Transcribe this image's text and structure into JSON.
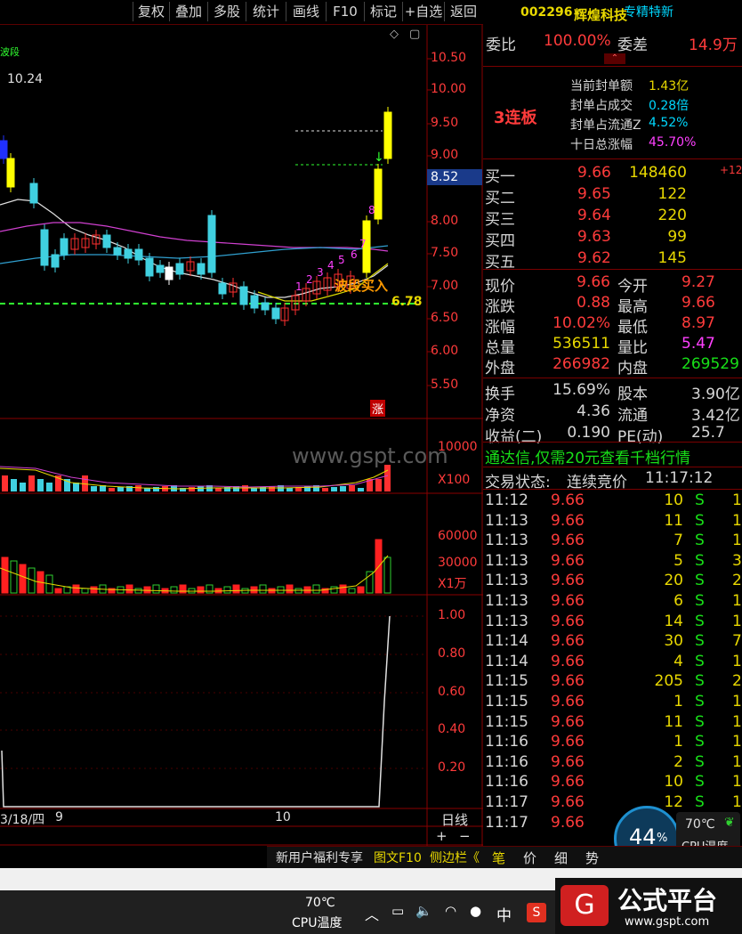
{
  "toolbar": {
    "items": [
      "复权",
      "叠加",
      "多股",
      "统计",
      "画线",
      "F10",
      "标记",
      "+自选",
      "返回"
    ]
  },
  "stock": {
    "code": "002296",
    "name": "辉煌科技",
    "tag": "专精特新"
  },
  "weibi": {
    "label1": "委比",
    "val1": "100.00%",
    "label2": "委差",
    "val2": "14.9万"
  },
  "seal": {
    "streak": "3连板",
    "rows": [
      {
        "label": "当前封单额",
        "value": "1.43亿"
      },
      {
        "label": "封单占成交",
        "value": "0.28倍"
      },
      {
        "label": "封单占流通Z",
        "value": "4.52%"
      },
      {
        "label": "十日总涨幅",
        "value": "45.70%"
      }
    ]
  },
  "bids": [
    {
      "label": "买一",
      "price": "9.66",
      "vol": "148460",
      "extra": "+12"
    },
    {
      "label": "买二",
      "price": "9.65",
      "vol": "122",
      "extra": ""
    },
    {
      "label": "买三",
      "price": "9.64",
      "vol": "220",
      "extra": ""
    },
    {
      "label": "买四",
      "price": "9.63",
      "vol": "99",
      "extra": ""
    },
    {
      "label": "买五",
      "price": "9.62",
      "vol": "145",
      "extra": ""
    }
  ],
  "quote": [
    {
      "l1": "现价",
      "v1": "9.66",
      "l2": "今开",
      "v2": "9.27"
    },
    {
      "l1": "涨跌",
      "v1": "0.88",
      "l2": "最高",
      "v2": "9.66"
    },
    {
      "l1": "涨幅",
      "v1": "10.02%",
      "l2": "最低",
      "v2": "8.97"
    },
    {
      "l1": "总量",
      "v1": "536511",
      "l2": "量比",
      "v2": "5.47"
    },
    {
      "l1": "外盘",
      "v1": "266982",
      "l2": "内盘",
      "v2": "269529"
    }
  ],
  "fund": [
    {
      "l1": "换手",
      "v1": "15.69%",
      "l2": "股本",
      "v2": "3.90亿"
    },
    {
      "l1": "净资",
      "v1": "4.36",
      "l2": "流通",
      "v2": "3.42亿"
    },
    {
      "l1": "收益(二)",
      "v1": "0.190",
      "l2": "PE(动)",
      "v2": "25.7"
    }
  ],
  "ad": "通达信,仅需20元查看千档行情",
  "trade_status": {
    "label": "交易状态:",
    "status": "连续竞价",
    "time": "11:17:12"
  },
  "trades": [
    {
      "t": "11:12",
      "p": "9.66",
      "v": "10",
      "s": "S",
      "x": "1"
    },
    {
      "t": "11:13",
      "p": "9.66",
      "v": "11",
      "s": "S",
      "x": "1"
    },
    {
      "t": "11:13",
      "p": "9.66",
      "v": "7",
      "s": "S",
      "x": "1"
    },
    {
      "t": "11:13",
      "p": "9.66",
      "v": "5",
      "s": "S",
      "x": "3"
    },
    {
      "t": "11:13",
      "p": "9.66",
      "v": "20",
      "s": "S",
      "x": "2"
    },
    {
      "t": "11:13",
      "p": "9.66",
      "v": "6",
      "s": "S",
      "x": "1"
    },
    {
      "t": "11:13",
      "p": "9.66",
      "v": "14",
      "s": "S",
      "x": "1"
    },
    {
      "t": "11:14",
      "p": "9.66",
      "v": "30",
      "s": "S",
      "x": "7"
    },
    {
      "t": "11:14",
      "p": "9.66",
      "v": "4",
      "s": "S",
      "x": "1"
    },
    {
      "t": "11:15",
      "p": "9.66",
      "v": "205",
      "s": "S",
      "x": "2"
    },
    {
      "t": "11:15",
      "p": "9.66",
      "v": "1",
      "s": "S",
      "x": "1"
    },
    {
      "t": "11:15",
      "p": "9.66",
      "v": "11",
      "s": "S",
      "x": "1"
    },
    {
      "t": "11:16",
      "p": "9.66",
      "v": "1",
      "s": "S",
      "x": "1"
    },
    {
      "t": "11:16",
      "p": "9.66",
      "v": "2",
      "s": "S",
      "x": "1"
    },
    {
      "t": "11:16",
      "p": "9.66",
      "v": "10",
      "s": "S",
      "x": "1"
    },
    {
      "t": "11:17",
      "p": "9.66",
      "v": "12",
      "s": "S",
      "x": "1"
    },
    {
      "t": "11:17",
      "p": "9.66",
      "v": "",
      "s": "",
      "x": ""
    }
  ],
  "chart": {
    "price_axis": [
      "10.50",
      "10.00",
      "9.50",
      "9.00",
      "8.52",
      "8.00",
      "7.50",
      "7.00",
      "6.50",
      "6.00",
      "5.50"
    ],
    "vol_axis": [
      "10000",
      "X100"
    ],
    "vol2_axis": [
      "60000",
      "30000",
      "X1万"
    ],
    "ind_axis": [
      "1.00",
      "0.80",
      "0.60",
      "0.40",
      "0.20"
    ],
    "ma_label": "10.24",
    "top_left_fragment": "波段",
    "buy_signal": "波段买入",
    "support_label": "6.78",
    "limit_tag": "涨",
    "watermark": "www.gspt.com",
    "date_label": "3/18/四",
    "month_9": "9",
    "month_10": "10",
    "period": "日线",
    "zoom_in": "+",
    "zoom_out": "−",
    "numbers": [
      "1",
      "2",
      "3",
      "4",
      "5",
      "6",
      "7",
      "8"
    ]
  },
  "bottom_tabs": {
    "left": [
      "新用户福利专享",
      "图文F10",
      "侧边栏《"
    ],
    "right": [
      "笔",
      "价",
      "细",
      "势"
    ]
  },
  "cpu_widget": {
    "percent": "44",
    "unit": "%",
    "temp": "70℃",
    "label": "CPU温度"
  },
  "taskbar": {
    "temp": "70℃",
    "label": "CPU温度",
    "ime": "中"
  },
  "logo": {
    "text": "公式平台",
    "url": "www.gspt.com"
  }
}
